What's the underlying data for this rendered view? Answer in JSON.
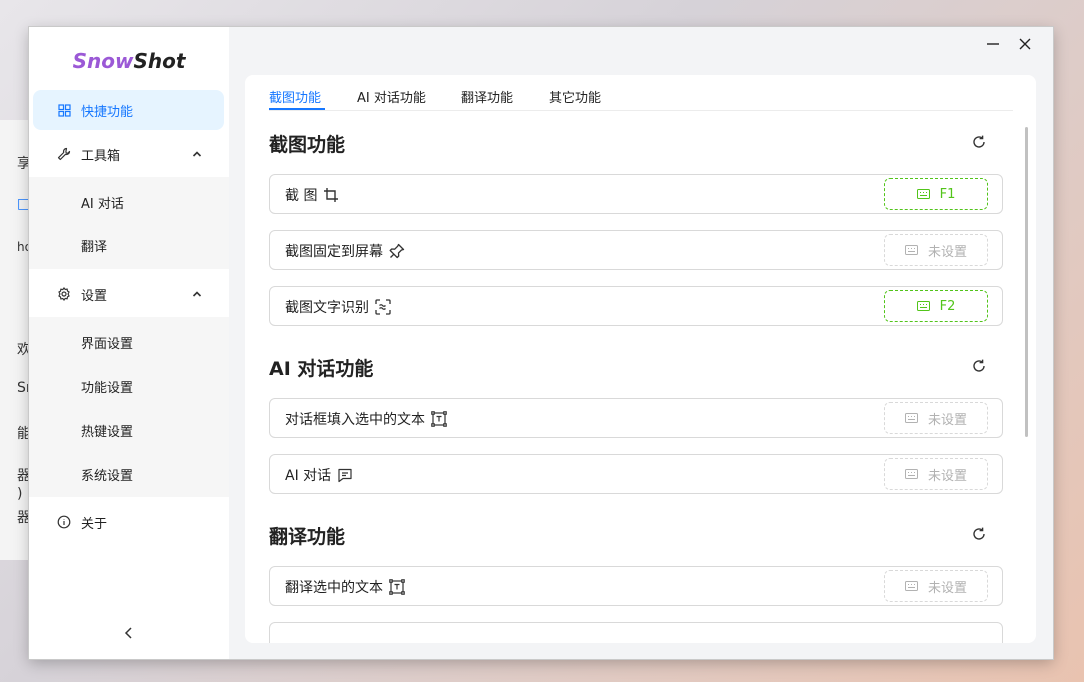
{
  "background_fragments": [
    "享",
    "□",
    "ho",
    "欢",
    "Sr",
    "能",
    "器",
    ")",
    "器"
  ],
  "app": {
    "logo": {
      "part1": "Snow",
      "part2": "Shot"
    },
    "colors": {
      "accent": "#1677ff",
      "active_bg": "#e6f4ff",
      "hotkey_set": "#52c41a",
      "logo_snow": "#9b59d6"
    }
  },
  "sidebar": {
    "items": [
      {
        "label": "快捷功能",
        "icon": "grid-icon",
        "active": true
      },
      {
        "label": "工具箱",
        "icon": "wrench-icon",
        "expanded": true
      },
      {
        "label": "AI 对话",
        "sub": true
      },
      {
        "label": "翻译",
        "sub": true
      },
      {
        "label": "设置",
        "icon": "gear-icon",
        "expanded": true
      },
      {
        "label": "界面设置",
        "sub": true
      },
      {
        "label": "功能设置",
        "sub": true
      },
      {
        "label": "热键设置",
        "sub": true
      },
      {
        "label": "系统设置",
        "sub": true
      },
      {
        "label": "关于",
        "icon": "info-icon"
      }
    ],
    "collapse_icon": "chevron-left-icon"
  },
  "window_controls": {
    "minimize": "minimize-icon",
    "close": "close-icon"
  },
  "tabs": [
    {
      "label": "截图功能",
      "active": true
    },
    {
      "label": "AI 对话功能"
    },
    {
      "label": "翻译功能"
    },
    {
      "label": "其它功能"
    }
  ],
  "sections": [
    {
      "title": "截图功能",
      "rows": [
        {
          "label": "截 图",
          "icon": "crop-icon",
          "hotkey": "F1",
          "set": true
        },
        {
          "label": "截图固定到屏幕",
          "icon": "pin-icon",
          "hotkey": "未设置",
          "set": false
        },
        {
          "label": "截图文字识别",
          "icon": "scan-text-icon",
          "hotkey": "F2",
          "set": true
        }
      ]
    },
    {
      "title": "AI 对话功能",
      "rows": [
        {
          "label": "对话框填入选中的文本",
          "icon": "text-select-icon",
          "hotkey": "未设置",
          "set": false
        },
        {
          "label": "AI 对话",
          "icon": "chat-icon",
          "hotkey": "未设置",
          "set": false
        }
      ]
    },
    {
      "title": "翻译功能",
      "rows": [
        {
          "label": "翻译选中的文本",
          "icon": "text-select-icon",
          "hotkey": "未设置",
          "set": false
        }
      ]
    }
  ]
}
